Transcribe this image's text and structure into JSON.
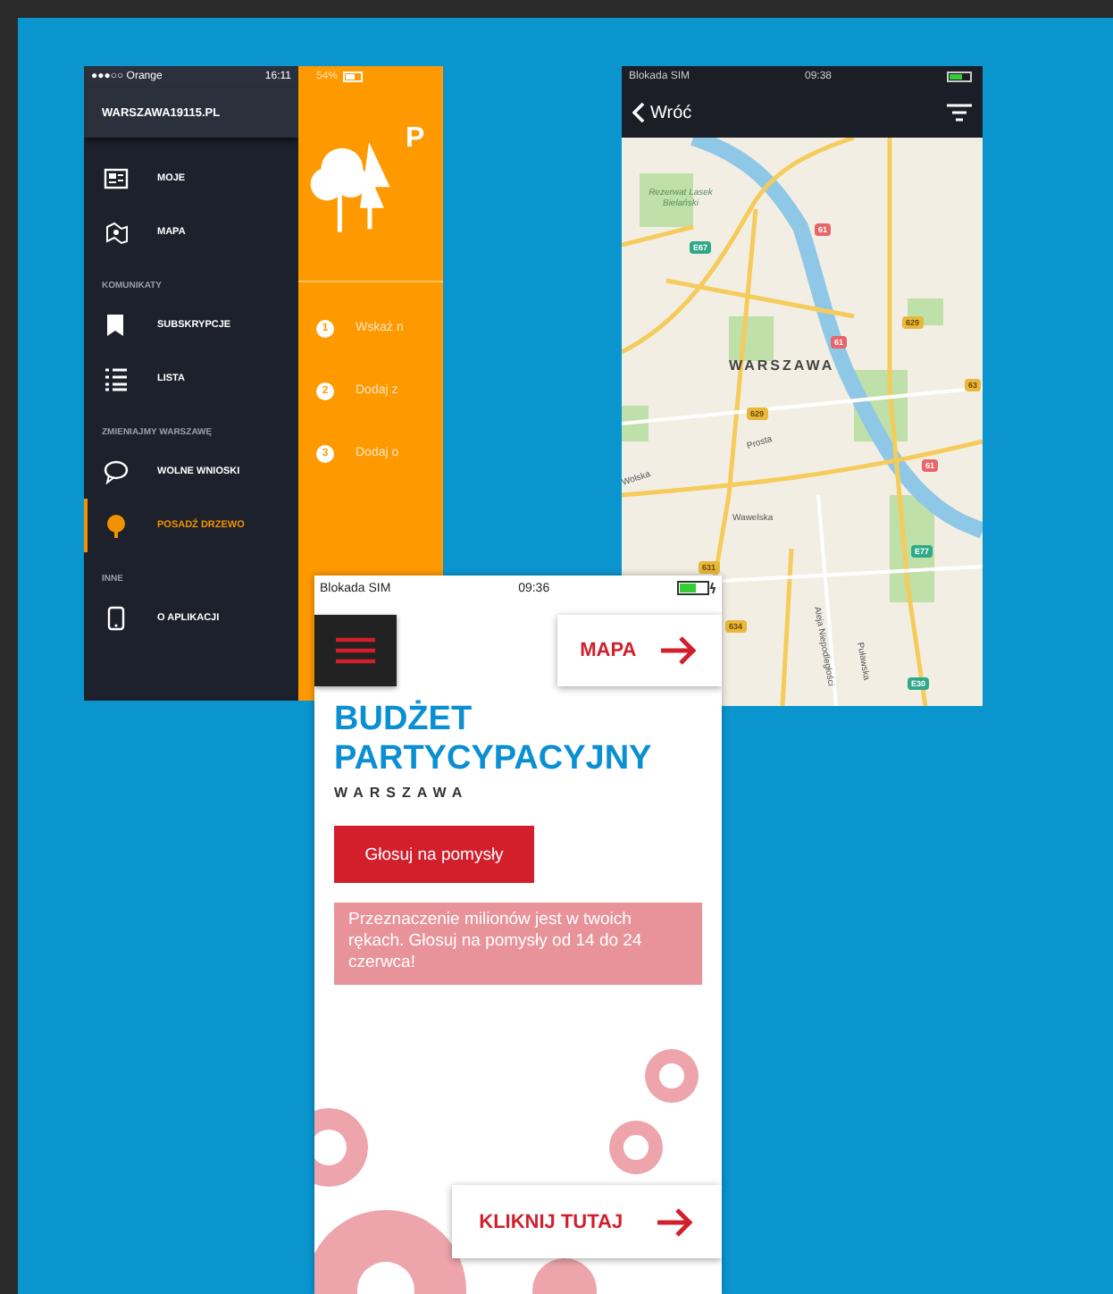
{
  "menu_phone": {
    "status_bar": {
      "carrier": "●●●○○ Orange",
      "time": "16:11",
      "battery": "54%"
    },
    "header": "WARSZAWA19115.PL",
    "items": [
      {
        "kind": "item",
        "label": "MOJE",
        "selected": false
      },
      {
        "kind": "item",
        "label": "MAPA",
        "selected": false
      },
      {
        "kind": "section",
        "label": "KOMUNIKATY"
      },
      {
        "kind": "item",
        "label": "SUBSKRYPCJE",
        "selected": false
      },
      {
        "kind": "item",
        "label": "LISTA",
        "selected": false
      },
      {
        "kind": "section",
        "label": "ZMIENIAJMY WARSZAWĘ"
      },
      {
        "kind": "item",
        "label": "WOLNE WNIOSKI",
        "selected": false
      },
      {
        "kind": "item",
        "label": "POSADŹ DRZEWO",
        "selected": true
      },
      {
        "kind": "section",
        "label": "INNE"
      },
      {
        "kind": "item",
        "label": "O APLIKACJI",
        "selected": false
      }
    ],
    "panel": {
      "title": "P",
      "steps": [
        {
          "number": "1",
          "text": "Wskaż n"
        },
        {
          "number": "2",
          "text": "Dodaj z"
        },
        {
          "number": "3",
          "text": "Dodaj o"
        }
      ]
    }
  },
  "map_phone": {
    "status_bar": {
      "carrier": "Blokada SIM",
      "time": "09:38"
    },
    "back": "Wróć",
    "labels": [
      {
        "kind": "park",
        "text": "Rezerwat Lasek Bielański"
      },
      {
        "kind": "route-red",
        "text": "61"
      },
      {
        "kind": "route-green",
        "text": "E67"
      },
      {
        "kind": "route-yellow",
        "text": "629"
      },
      {
        "kind": "route-red",
        "text": "61"
      },
      {
        "kind": "city",
        "text": "WARSZAWA"
      },
      {
        "kind": "route-yellow",
        "text": "63"
      },
      {
        "kind": "route-yellow",
        "text": "629"
      },
      {
        "kind": "street",
        "text": "Prosta"
      },
      {
        "kind": "street",
        "text": "Wolska"
      },
      {
        "kind": "route-red",
        "text": "61"
      },
      {
        "kind": "street",
        "text": "Wawelska"
      },
      {
        "kind": "route-green",
        "text": "E77"
      },
      {
        "kind": "route-yellow",
        "text": "631"
      },
      {
        "kind": "street",
        "text": "Aleja Niepodległości"
      },
      {
        "kind": "route-yellow",
        "text": "634"
      },
      {
        "kind": "street",
        "text": "Puławska"
      },
      {
        "kind": "route-green",
        "text": "E30"
      }
    ]
  },
  "budget_phone": {
    "status_bar": {
      "carrier": "Blokada SIM",
      "time": "09:36"
    },
    "map_button": "MAPA",
    "title": "BUDŻET PARTYCYPACYJNY",
    "subtitle": "WARSZAWA",
    "vote_button": "Głosuj na pomysły",
    "notice": "Przeznaczenie milionów jest w twoich rękach. Głosuj na pomysły od 14 do 24 czerwca!",
    "click_button": "KLIKNIJ TUTAJ"
  }
}
